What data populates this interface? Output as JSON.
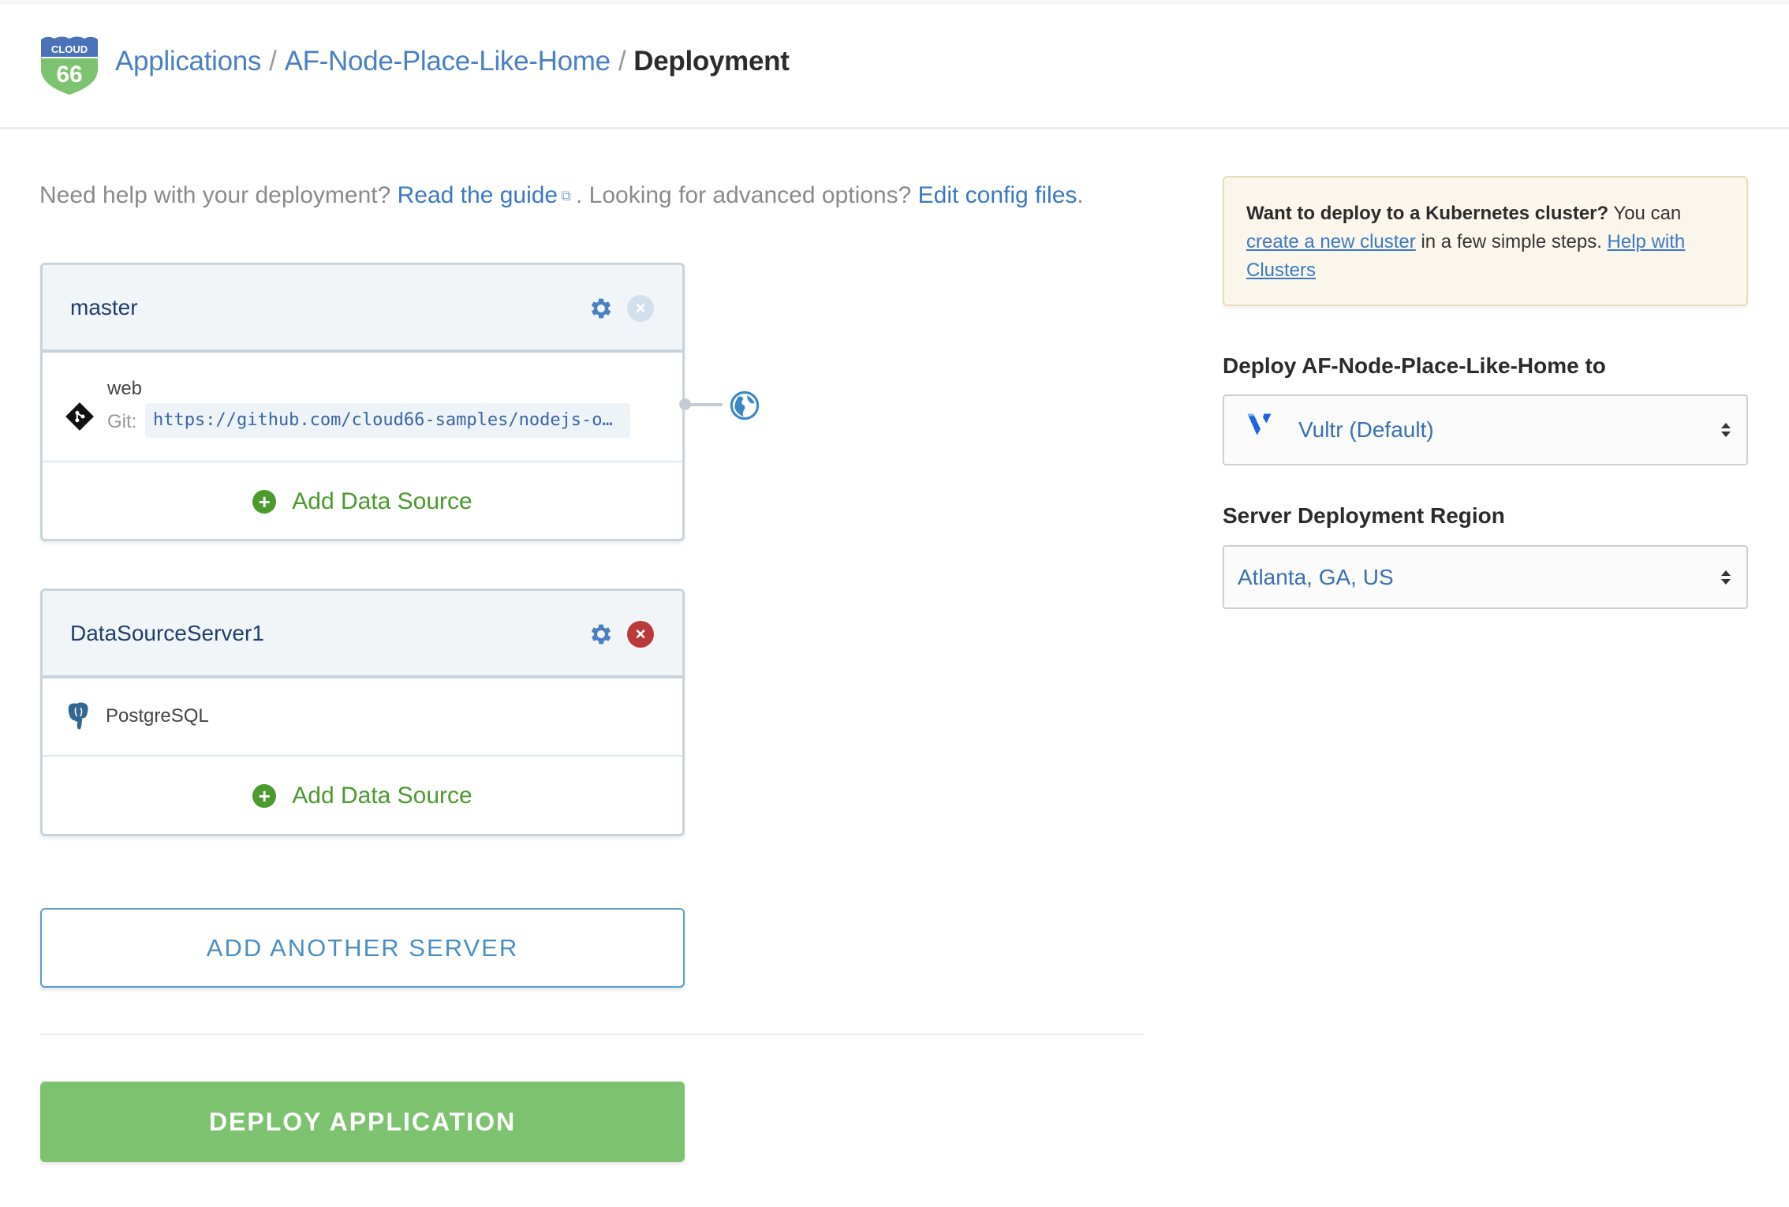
{
  "header": {
    "logo": {
      "top_text": "CLOUD",
      "bottom_text": "66",
      "top_color": "#4a72b8",
      "bottom_color": "#7cc26f"
    },
    "breadcrumb": [
      {
        "label": "Applications",
        "link": true
      },
      {
        "label": "AF-Node-Place-Like-Home",
        "link": true
      },
      {
        "label": "Deployment",
        "link": false
      }
    ],
    "separator": "/"
  },
  "help": {
    "prefix": "Need help with your deployment?",
    "guide_link": "Read the guide",
    "middle": ". Looking for advanced options?",
    "config_link": "Edit config files",
    "suffix": "."
  },
  "servers": [
    {
      "name": "master",
      "remove_enabled": false,
      "service": {
        "name": "web",
        "git_label": "Git:",
        "git_url": "https://github.com/cloud66-samples/nodejs-o…"
      },
      "add_data_source_label": "Add Data Source",
      "public": true
    },
    {
      "name": "DataSourceServer1",
      "remove_enabled": true,
      "data_source": {
        "name": "PostgreSQL"
      },
      "add_data_source_label": "Add Data Source"
    }
  ],
  "actions": {
    "add_server_label": "ADD ANOTHER SERVER",
    "deploy_label": "DEPLOY APPLICATION"
  },
  "notice": {
    "bold": "Want to deploy to a Kubernetes cluster?",
    "text1": " You can ",
    "link1": "create a new cluster",
    "text2": " in a few simple steps. ",
    "link2": "Help with Clusters"
  },
  "deploy_target": {
    "label": "Deploy AF-Node-Place-Like-Home to",
    "selected": "Vultr (Default)",
    "provider_icon": "vultr-logo-icon"
  },
  "region": {
    "label": "Server Deployment Region",
    "selected": "Atlanta, GA, US"
  },
  "colors": {
    "link": "#3b78c3",
    "success": "#7cc26f",
    "add_green": "#4a9a2d",
    "danger": "#b93a3a"
  }
}
